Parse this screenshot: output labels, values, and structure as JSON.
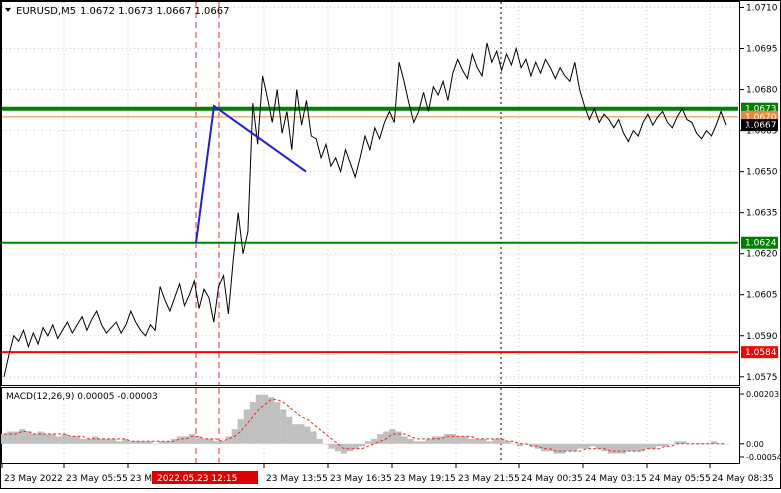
{
  "header": {
    "symbol": "EURUSD,M5",
    "ohlc": "1.0672 1.0673 1.0667 1.0667"
  },
  "macd": {
    "label": "MACD(12,26,9) 0.00005 -0.00003",
    "ticks": [
      "0.00203",
      "0.00",
      "-0.00054"
    ]
  },
  "price_axis": {
    "ticks": [
      "1.0710",
      "1.0695",
      "1.0680",
      "1.0665",
      "1.0650",
      "1.0635",
      "1.0620",
      "1.0605",
      "1.0590",
      "1.0575"
    ]
  },
  "levels": [
    {
      "value": 1.0673,
      "label": "1.0673",
      "color": "#008000"
    },
    {
      "value": 1.067,
      "label": "1.0670",
      "color": "#e8893a"
    },
    {
      "value": 1.0667,
      "label": "1.0667",
      "color": "#000000"
    },
    {
      "value": 1.0624,
      "label": "1.0624",
      "color": "#008000"
    },
    {
      "value": 1.0584,
      "label": "1.0584",
      "color": "#ff0000"
    }
  ],
  "time_axis": {
    "labels": [
      "23 May 2022",
      "23 May 05:55",
      "23 Ma",
      "23 May 13:55",
      "23 May 16:35",
      "23 May 19:15",
      "23 May 21:55",
      "24 May 00:35",
      "24 May 03:15",
      "24 May 05:55",
      "24 May 08:35"
    ],
    "cursor_label": "2022.05.23 12:15"
  },
  "chart_data": {
    "type": "line",
    "title": "EURUSD,M5",
    "ylim": [
      1.0572,
      1.0712
    ],
    "series": [
      {
        "values": [
          1.0575,
          1.0583,
          1.059,
          1.0588,
          1.0592,
          1.0586,
          1.0591,
          1.0587,
          1.0593,
          1.059,
          1.0594,
          1.0589,
          1.0592,
          1.0595,
          1.0591,
          1.0594,
          1.0597,
          1.0592,
          1.0596,
          1.0599,
          1.0594,
          1.0591,
          1.0593,
          1.0595,
          1.0591,
          1.0594,
          1.0599,
          1.0595,
          1.0592,
          1.059,
          1.0594,
          1.0592,
          1.0608,
          1.0603,
          1.0599,
          1.0604,
          1.0609,
          1.0601,
          1.0605,
          1.061,
          1.06,
          1.0607,
          1.0604,
          1.0595,
          1.0608,
          1.0612,
          1.0598,
          1.0618,
          1.0635,
          1.062,
          1.0628,
          1.0675,
          1.066,
          1.0685,
          1.0677,
          1.0668,
          1.068,
          1.0664,
          1.0672,
          1.0658,
          1.068,
          1.0667,
          1.0676,
          1.0663,
          1.0662,
          1.0655,
          1.066,
          1.0652,
          1.0655,
          1.065,
          1.0658,
          1.0653,
          1.0648,
          1.0655,
          1.0663,
          1.0658,
          1.0666,
          1.0662,
          1.0668,
          1.0672,
          1.0668,
          1.069,
          1.0683,
          1.0675,
          1.0668,
          1.0672,
          1.0679,
          1.0672,
          1.0681,
          1.0678,
          1.0683,
          1.0676,
          1.0686,
          1.0691,
          1.0687,
          1.0684,
          1.0693,
          1.0688,
          1.0685,
          1.0697,
          1.069,
          1.0694,
          1.0687,
          1.0693,
          1.0689,
          1.0695,
          1.0688,
          1.0691,
          1.0685,
          1.069,
          1.0686,
          1.0691,
          1.0688,
          1.0684,
          1.0688,
          1.0685,
          1.0683,
          1.069,
          1.068,
          1.0674,
          1.0669,
          1.0673,
          1.0668,
          1.0671,
          1.0669,
          1.0666,
          1.0669,
          1.0664,
          1.0661,
          1.0665,
          1.0663,
          1.0668,
          1.0671,
          1.0667,
          1.067,
          1.0672,
          1.0668,
          1.0666,
          1.067,
          1.0673,
          1.0669,
          1.0668,
          1.0664,
          1.0662,
          1.0665,
          1.0663,
          1.0667,
          1.0672,
          1.0667
        ]
      }
    ],
    "trend_lines": [
      {
        "color": "#1f1fe0",
        "points": [
          1.0624,
          1.0674,
          1.065
        ]
      }
    ],
    "macd_histogram": [
      0.0004,
      0.0005,
      0.0005,
      0.0006,
      0.0005,
      0.0004,
      0.0005,
      0.0004,
      0.0004,
      0.0003,
      0.0004,
      0.0003,
      0.0003,
      0.0002,
      0.0002,
      0.0003,
      0.0002,
      0.0002,
      0.0002,
      0.0001,
      0.0002,
      0.0001,
      0.0001,
      0.0001,
      0.0001,
      0.0,
      0.0001,
      0.0001,
      0.0002,
      0.0003,
      0.0003,
      0.0004,
      0.0003,
      0.0002,
      0.0002,
      0.0001,
      0.0001,
      0.0003,
      0.0006,
      0.001,
      0.0014,
      0.0017,
      0.002,
      0.002,
      0.0019,
      0.0017,
      0.0014,
      0.0011,
      0.0008,
      0.0008,
      0.0007,
      0.0005,
      0.0002,
      0.0,
      -0.0002,
      -0.0003,
      -0.0004,
      -0.0003,
      -0.0002,
      -0.0001,
      0.0001,
      0.0002,
      0.0004,
      0.0005,
      0.0006,
      0.0005,
      0.0003,
      0.0002,
      0.0001,
      0.0001,
      0.0002,
      0.0003,
      0.0003,
      0.0004,
      0.0004,
      0.0003,
      0.0003,
      0.0002,
      0.0002,
      0.0002,
      0.0001,
      0.0002,
      0.0002,
      0.0001,
      0.0,
      -0.0001,
      0.0,
      -0.0001,
      -0.0002,
      -0.0003,
      -0.0003,
      -0.0004,
      -0.0004,
      -0.0003,
      -0.0003,
      -0.0002,
      -0.0002,
      -0.0001,
      -0.0002,
      -0.0003,
      -0.0004,
      -0.0004,
      -0.0004,
      -0.0003,
      -0.0003,
      -0.0003,
      -0.0002,
      -0.0002,
      -0.0001,
      -0.0001,
      0.0,
      0.0001,
      0.0001,
      0.0,
      0.0,
      0.0,
      0.0,
      0.0001,
      0.0,
      0.0
    ],
    "macd_signal": [
      0.0004,
      0.0004,
      0.0004,
      0.0005,
      0.0005,
      0.0004,
      0.0004,
      0.0004,
      0.0004,
      0.0004,
      0.0004,
      0.0003,
      0.0003,
      0.0003,
      0.0002,
      0.0002,
      0.0002,
      0.0002,
      0.0002,
      0.0002,
      0.0002,
      0.0001,
      0.0001,
      0.0001,
      0.0001,
      0.0001,
      0.0001,
      0.0001,
      0.0001,
      0.0002,
      0.0002,
      0.0003,
      0.0003,
      0.0002,
      0.0002,
      0.0002,
      0.0001,
      0.0002,
      0.0003,
      0.0005,
      0.0008,
      0.0011,
      0.0014,
      0.0016,
      0.0018,
      0.0018,
      0.0017,
      0.0015,
      0.0013,
      0.0011,
      0.001,
      0.0008,
      0.0006,
      0.0004,
      0.0002,
      0.0,
      -0.0002,
      -0.0002,
      -0.0002,
      -0.0002,
      -0.0001,
      0.0,
      0.0001,
      0.0002,
      0.0004,
      0.0004,
      0.0004,
      0.0003,
      0.0002,
      0.0002,
      0.0002,
      0.0002,
      0.0002,
      0.0003,
      0.0003,
      0.0003,
      0.0003,
      0.0003,
      0.0002,
      0.0002,
      0.0002,
      0.0002,
      0.0002,
      0.0001,
      0.0001,
      0.0,
      0.0,
      -0.0001,
      -0.0001,
      -0.0002,
      -0.0002,
      -0.0003,
      -0.0003,
      -0.0003,
      -0.0003,
      -0.0003,
      -0.0002,
      -0.0002,
      -0.0002,
      -0.0002,
      -0.0003,
      -0.0003,
      -0.0003,
      -0.0003,
      -0.0003,
      -0.0003,
      -0.0002,
      -0.0002,
      -0.0002,
      -0.0001,
      -0.0001,
      0.0,
      0.0,
      0.0,
      0.0,
      0.0,
      0.0,
      0.0,
      0.0,
      0.0
    ],
    "macd_ylim": [
      -0.00054,
      0.00203
    ],
    "grid": true
  }
}
